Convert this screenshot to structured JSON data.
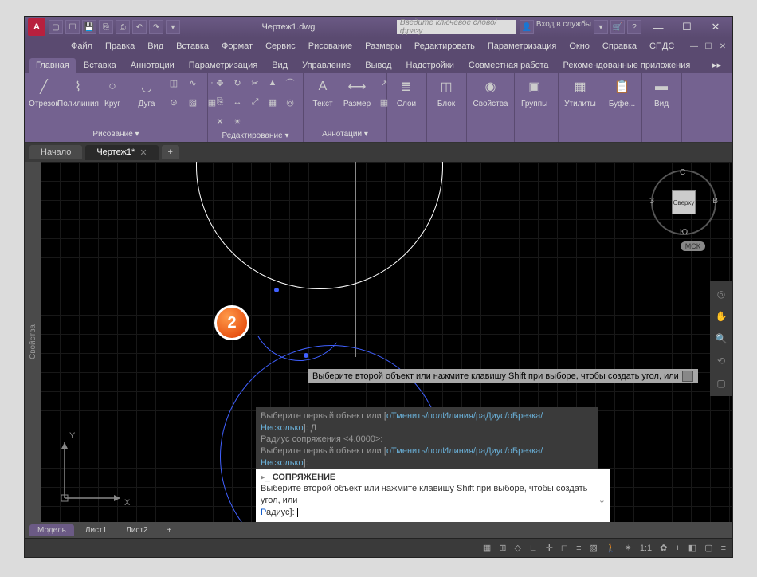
{
  "title": "Чертеж1.dwg",
  "search_placeholder": "Введите ключевое слово/фразу",
  "signin": "Вход в службы",
  "menu": [
    "Файл",
    "Правка",
    "Вид",
    "Вставка",
    "Формат",
    "Сервис",
    "Рисование",
    "Размеры",
    "Редактировать",
    "Параметризация",
    "Окно",
    "Справка",
    "СПДС"
  ],
  "ribbon_tabs": [
    "Главная",
    "Вставка",
    "Аннотации",
    "Параметризация",
    "Вид",
    "Управление",
    "Вывод",
    "Надстройки",
    "Совместная работа",
    "Рекомендованные приложения"
  ],
  "panels": {
    "draw": {
      "title": "Рисование ▾",
      "btns": [
        "Отрезок",
        "Полилиния",
        "Круг",
        "Дуга"
      ]
    },
    "modify": {
      "title": "Редактирование ▾"
    },
    "annot": {
      "title": "Аннотации ▾",
      "btns": [
        "Текст",
        "Размер"
      ]
    },
    "layers": "Слои",
    "block": "Блок",
    "props": "Свойства",
    "groups": "Группы",
    "utils": "Утилиты",
    "clip": "Буфе...",
    "view": "Вид"
  },
  "doc_tabs": {
    "start": "Начало",
    "active": "Чертеж1*"
  },
  "side_palette": "Свойства",
  "badge": "2",
  "tooltip": "Выберите второй объект или нажмите клавишу Shift при выборе, чтобы создать угол, или",
  "hist": {
    "l1a": "Выберите первый объект или [",
    "l1b": "оТменить/полИлиния/раДиус/оБрезка/",
    "l1c": "Несколько",
    "l1d": "]: Д",
    "l2": "Радиус сопряжения <4.0000>:",
    "l3a": "Выберите первый объект или [",
    "l3b": "оТменить/полИлиния/раДиус/оБрезка/",
    "l3c": "Несколько",
    "l3d": "]:"
  },
  "cmd": {
    "name": "СОПРЯЖЕНИЕ",
    "body": "Выберите второй объект или нажмите клавишу Shift при выборе, чтобы создать угол, или",
    "last_key": "Р",
    "last_rest": "адиус]:"
  },
  "viewcube": {
    "top": "Сверху",
    "n": "С",
    "s": "Ю",
    "e": "В",
    "w": "З",
    "wcs": "МСК"
  },
  "ucs": {
    "x": "X",
    "y": "Y"
  },
  "layout_tabs": [
    "Модель",
    "Лист1",
    "Лист2"
  ],
  "status": {
    "scale": "1:1",
    "gear": "✿"
  }
}
